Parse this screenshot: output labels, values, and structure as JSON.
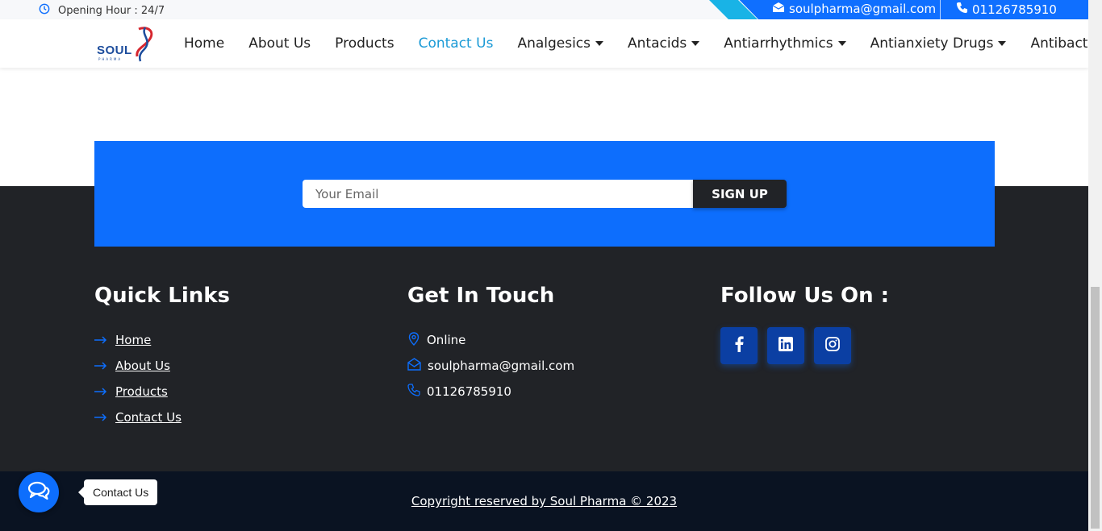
{
  "topbar": {
    "hours": "Opening Hour : 24/7",
    "email": "soulpharma@gmail.com",
    "phone": "01126785910"
  },
  "logo": {
    "word": "SOUL",
    "sub": "PHARMA"
  },
  "nav": {
    "items": [
      {
        "label": "Home",
        "dropdown": false,
        "active": false
      },
      {
        "label": "About Us",
        "dropdown": false,
        "active": false
      },
      {
        "label": "Products",
        "dropdown": false,
        "active": false
      },
      {
        "label": "Contact Us",
        "dropdown": false,
        "active": true
      },
      {
        "label": "Analgesics",
        "dropdown": true,
        "active": false
      },
      {
        "label": "Antacids",
        "dropdown": true,
        "active": false
      },
      {
        "label": "Antiarrhythmics",
        "dropdown": true,
        "active": false
      },
      {
        "label": "Antianxiety Drugs",
        "dropdown": true,
        "active": false
      },
      {
        "label": "Antibacterials",
        "dropdown": true,
        "active": false
      }
    ]
  },
  "newsletter": {
    "placeholder": "Your Email",
    "button": "SIGN UP"
  },
  "footer": {
    "quick_links": {
      "title": "Quick Links",
      "items": [
        "Home",
        "About Us",
        "Products",
        "Contact Us"
      ]
    },
    "get_in_touch": {
      "title": "Get In Touch",
      "location": "Online",
      "email": "soulpharma@gmail.com",
      "phone": "01126785910"
    },
    "follow": {
      "title": "Follow Us On :",
      "icons": [
        "facebook-icon",
        "linkedin-icon",
        "instagram-icon"
      ]
    },
    "copyright": "Copyright reserved by Soul Pharma © 2023"
  },
  "chat": {
    "tooltip": "Contact Us"
  },
  "colors": {
    "primary": "#0d6efd",
    "dark": "#212327",
    "active_nav": "#1b9ad6"
  }
}
